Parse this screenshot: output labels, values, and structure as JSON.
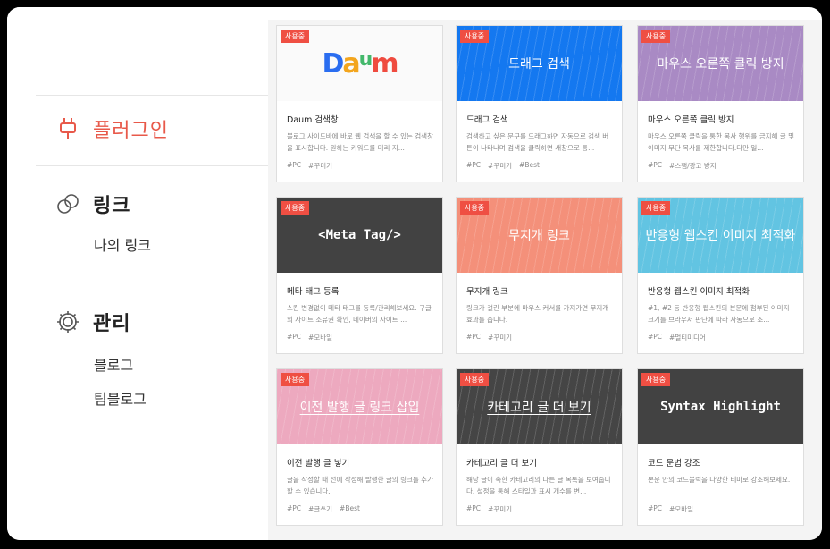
{
  "sidebar": {
    "sections": [
      {
        "label": "플러그인",
        "icon": "plug-icon",
        "active": true
      },
      {
        "label": "링크",
        "icon": "link-icon",
        "items": [
          "나의 링크"
        ]
      },
      {
        "label": "관리",
        "icon": "gear-icon",
        "items": [
          "블로그",
          "팀블로그"
        ]
      }
    ]
  },
  "badge_label": "사용중",
  "cards": [
    {
      "thumb_title": "Daum",
      "logo_letters": [
        "D",
        "a",
        "u",
        "m"
      ],
      "thumb_color": "#fafafa",
      "name": "Daum 검색창",
      "desc": "블로그 사이드바에 바로 웹 검색을 할 수 있는 검색창을 표시합니다. 원하는 키워드를 미리 지...",
      "tags": [
        "#PC",
        "#꾸미기"
      ]
    },
    {
      "thumb_title": "드래그 검색",
      "thumb_color": "#1478f0",
      "name": "드래그 검색",
      "desc": "검색하고 싶은 문구를 드래그하면 자동으로 검색 버튼이 나타나며 검색을 클릭하면 새창으로 통...",
      "tags": [
        "#PC",
        "#꾸미기",
        "#Best"
      ]
    },
    {
      "thumb_title": "마우스 오른쪽 클릭 방지",
      "thumb_color": "#a98ac4",
      "name": "마우스 오른쪽 클릭 방지",
      "desc": "마우스 오른쪽 클릭을 통한 복사 행위를 금지해 글 및 이미지 무단 복사를 제한합니다.다만 일...",
      "tags": [
        "#PC",
        "#스팸/광고 방지"
      ]
    },
    {
      "thumb_title": "<Meta Tag/>",
      "thumb_color": "#424242",
      "name": "메타 태그 등록",
      "desc": "스킨 변경없이 메타 태그를 등록/관리해보세요. 구글의 사이트 소유권 확인, 네이버의 사이트 ...",
      "tags": [
        "#PC",
        "#모바일"
      ]
    },
    {
      "thumb_title": "무지개 링크",
      "thumb_color": "#f4907a",
      "name": "무지개 링크",
      "desc": "링크가 걸린 부분에 마우스 커서를 가져가면 무지개 효과를 줍니다.",
      "tags": [
        "#PC",
        "#꾸미기"
      ]
    },
    {
      "thumb_title": "반응형 웹스킨 이미지 최적화",
      "thumb_color": "#62c4e2",
      "name": "반응형 웹스킨 이미지 최적화",
      "desc": "#1, #2 등 반응형 웹스킨의 본문에 첨부된 이미지 크기를 브라우저 판단에 따라 자동으로 조...",
      "tags": [
        "#PC",
        "#멀티미디어"
      ]
    },
    {
      "thumb_title": "이전 발행 글 링크 삽입",
      "thumb_color": "#eda9bf",
      "name": "이전 발행 글 넣기",
      "desc": "글을 작성할 때 전에 작성해 발행한 글의 링크를 추가할 수 있습니다.",
      "tags": [
        "#PC",
        "#글쓰기",
        "#Best"
      ]
    },
    {
      "thumb_title": "카테고리 글 더 보기",
      "thumb_color": "#454545",
      "name": "카테고리 글 더 보기",
      "desc": "해당 글이 속한 카테고리의 다른 글 목록을 보여줍니다. 설정을 통해 스타일과 표시 개수를 변...",
      "tags": [
        "#PC",
        "#꾸미기"
      ]
    },
    {
      "thumb_title": "Syntax Highlight",
      "thumb_color": "#424242",
      "name": "코드 문법 강조",
      "desc": "본문 안의 코드블럭을 다양한 테마로 강조해보세요.",
      "tags": [
        "#PC",
        "#모바일"
      ]
    }
  ]
}
